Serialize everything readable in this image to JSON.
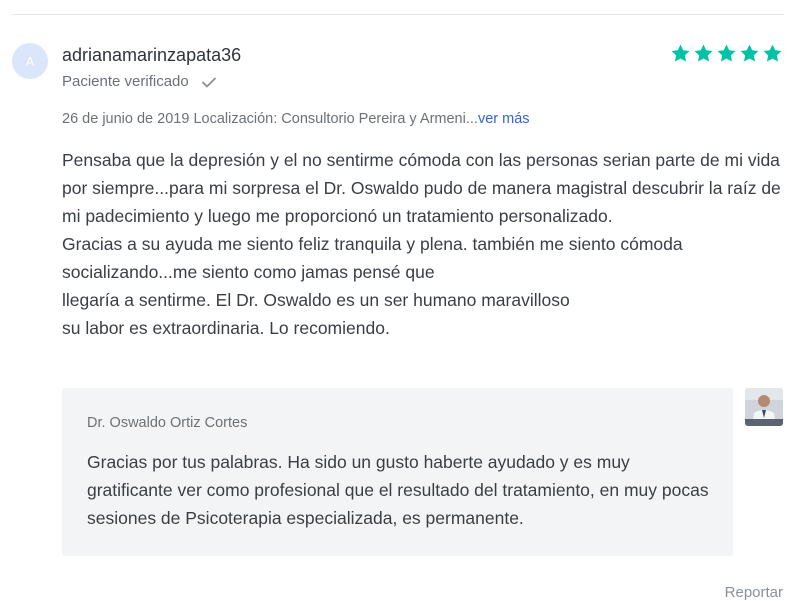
{
  "review": {
    "avatar_initial": "A",
    "username": "adrianamarinzapata36",
    "verified_label": "Paciente verificado",
    "rating": 5,
    "rating_max": 5,
    "star_color": "#00c3a5",
    "date": "26 de junio de 2019",
    "location_label": "Localización: Consultorio Pereira y Armeni...",
    "see_more": "ver más",
    "text_lines": [
      "Pensaba que la depresión y el no sentirme cómoda con las personas serian parte de mi vida por siempre...para mi sorpresa el Dr. Oswaldo pudo de manera magistral descubrir la raíz de mi padecimiento y luego me proporcionó un tratamiento personalizado.",
      "Gracias a su ayuda me siento feliz tranquila y plena. también me siento cómoda socializando...me siento como jamas pensé que",
      "llegaría a sentirme. El Dr. Oswaldo es un ser humano maravilloso",
      "su labor es extraordinaria. Lo recomiendo."
    ]
  },
  "reply": {
    "author": "Dr. Oswaldo Ortiz Cortes",
    "text": "Gracias por tus palabras. Ha sido un gusto haberte ayudado y es muy gratificante ver como profesional que el resultado del tratamiento, en muy pocas sesiones de Psicoterapia especializada, es permanente."
  },
  "actions": {
    "report_label": "Reportar"
  }
}
